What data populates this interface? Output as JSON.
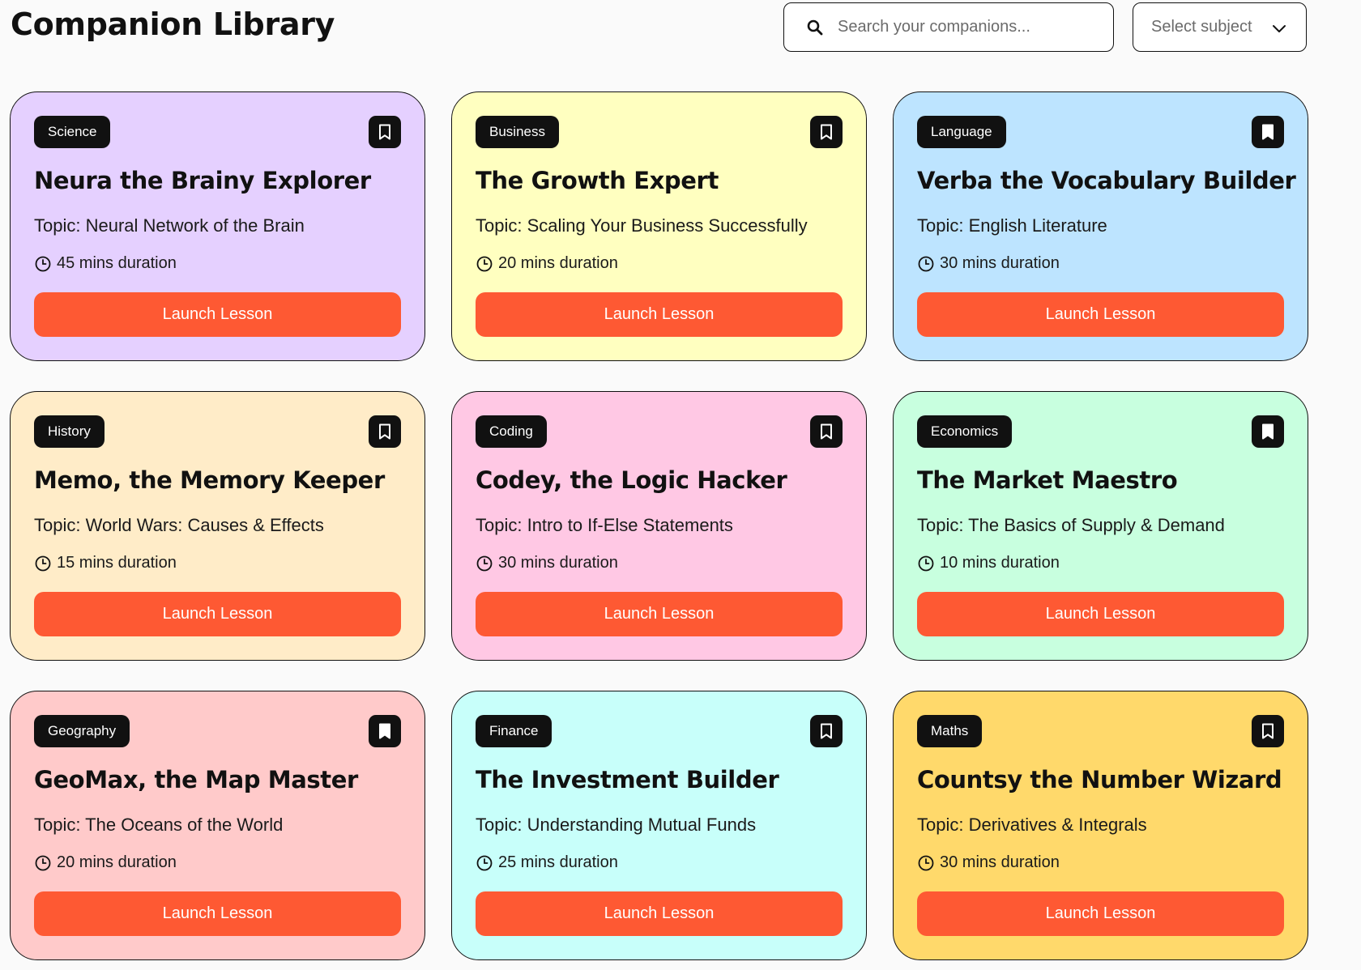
{
  "header": {
    "title": "Companion Library",
    "search_placeholder": "Search your companions...",
    "subject_select": "Select subject"
  },
  "cards": [
    {
      "subject": "Science",
      "title": "Neura the Brainy Explorer",
      "topic": "Topic: Neural Network of the Brain",
      "duration": "45 mins duration",
      "button": "Launch Lesson",
      "color": "#e5d0ff",
      "bookmarked": false
    },
    {
      "subject": "Business",
      "title": "The Growth Expert",
      "topic": "Topic: Scaling Your Business Successfully",
      "duration": "20 mins duration",
      "button": "Launch Lesson",
      "color": "#ffffc0",
      "bookmarked": false
    },
    {
      "subject": "Language",
      "title": "Verba the Vocabulary Builder",
      "topic": "Topic: English Literature",
      "duration": "30 mins duration",
      "button": "Launch Lesson",
      "color": "#bde4ff",
      "bookmarked": true
    },
    {
      "subject": "History",
      "title": "Memo, the Memory Keeper",
      "topic": "Topic: World Wars: Causes & Effects",
      "duration": "15 mins duration",
      "button": "Launch Lesson",
      "color": "#ffecc8",
      "bookmarked": false
    },
    {
      "subject": "Coding",
      "title": "Codey, the Logic Hacker",
      "topic": "Topic: Intro to If-Else Statements",
      "duration": "30 mins duration",
      "button": "Launch Lesson",
      "color": "#ffc8e4",
      "bookmarked": false
    },
    {
      "subject": "Economics",
      "title": "The Market Maestro",
      "topic": "Topic: The Basics of Supply & Demand",
      "duration": "10 mins duration",
      "button": "Launch Lesson",
      "color": "#c8ffdf",
      "bookmarked": true
    },
    {
      "subject": "Geography",
      "title": "GeoMax, the Map Master",
      "topic": "Topic: The Oceans of the World",
      "duration": "20 mins duration",
      "button": "Launch Lesson",
      "color": "#ffcaca",
      "bookmarked": true
    },
    {
      "subject": "Finance",
      "title": "The Investment Builder",
      "topic": "Topic: Understanding Mutual Funds",
      "duration": "25 mins duration",
      "button": "Launch Lesson",
      "color": "#c8fffa",
      "bookmarked": false
    },
    {
      "subject": "Maths",
      "title": "Countsy the Number Wizard",
      "topic": "Topic: Derivatives & Integrals",
      "duration": "30 mins duration",
      "button": "Launch Lesson",
      "color": "#ffd96b",
      "bookmarked": false
    }
  ]
}
